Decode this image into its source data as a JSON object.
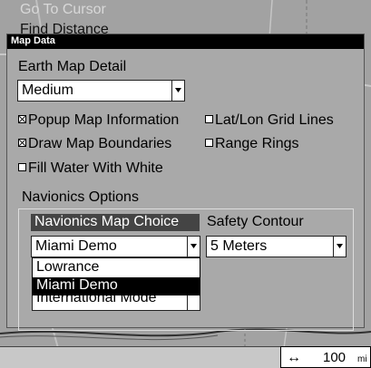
{
  "background_menu": {
    "item_1": "Go To Cursor",
    "item_2": "Find Distance"
  },
  "dialog": {
    "title": "Map Data",
    "earth_map_detail_label": "Earth Map Detail",
    "earth_map_detail_value": "Medium",
    "checkboxes": {
      "popup_map_information": {
        "label": "Popup Map Information",
        "checked": true
      },
      "lat_lon_grid_lines": {
        "label": "Lat/Lon Grid Lines",
        "checked": false
      },
      "draw_map_boundaries": {
        "label": "Draw Map Boundaries",
        "checked": true
      },
      "range_rings": {
        "label": "Range Rings",
        "checked": false
      },
      "fill_water_with_white": {
        "label": "Fill Water With White",
        "checked": false
      }
    },
    "navionics": {
      "group_label": "Navionics Options",
      "map_choice_label": "Navionics Map Choice",
      "map_choice_value": "Miami Demo",
      "map_choice_options": [
        "Lowrance",
        "Miami Demo"
      ],
      "selected_option": "Miami Demo",
      "safety_contour_label": "Safety Contour",
      "safety_contour_value": "5 Meters",
      "hidden_combo_value": "International Mode"
    }
  },
  "status_bar": {
    "scale_arrow": "↔",
    "scale_value": "100",
    "scale_unit": "mi"
  },
  "colors": {
    "dialog_bg": "#a9a9a9",
    "titlebar_bg": "#000000",
    "selected_bg": "#000000",
    "header_bg": "#444444"
  }
}
